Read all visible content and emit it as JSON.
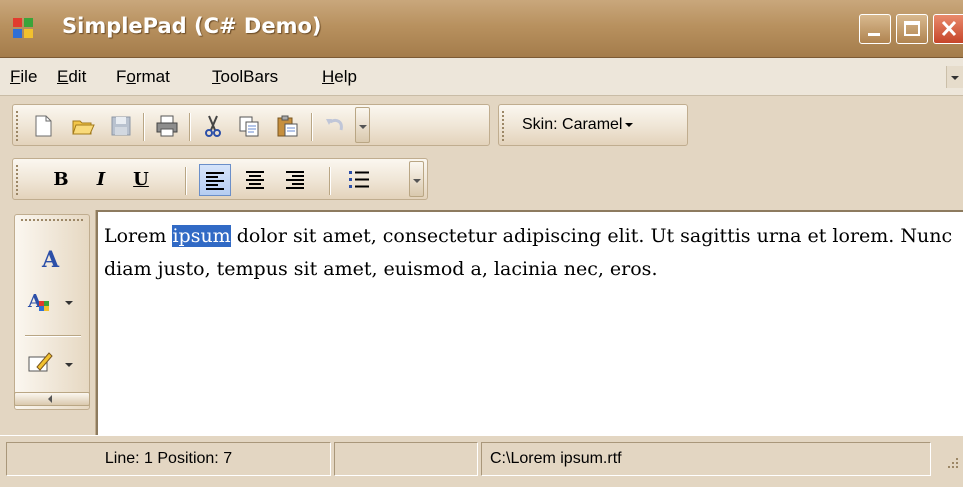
{
  "window": {
    "title": "SimplePad (C# Demo)",
    "controls": [
      "minimize-icon",
      "maximize-icon",
      "close-icon"
    ],
    "colors": {
      "titlebar": "#b8915f",
      "selection": "#316ac5",
      "background": "#e3d6c2"
    }
  },
  "menu": {
    "items": [
      {
        "label": "File",
        "mnemonic": "F"
      },
      {
        "label": "Edit",
        "mnemonic": "E"
      },
      {
        "label": "Format",
        "mnemonic": "o"
      },
      {
        "label": "ToolBars",
        "mnemonic": "T"
      },
      {
        "label": "Help",
        "mnemonic": "H"
      }
    ]
  },
  "toolbar_main": {
    "icons": [
      "new-document-icon",
      "open-folder-icon",
      "save-icon",
      "print-icon",
      "cut-icon",
      "copy-icon",
      "paste-icon",
      "undo-icon"
    ],
    "skin_label": "Skin: Caramel"
  },
  "toolbar_format": {
    "bold": "B",
    "italic": "I",
    "underline": "U",
    "active_alignment": "left",
    "icons": [
      "align-left-icon",
      "align-center-icon",
      "align-right-icon",
      "bullet-list-icon"
    ]
  },
  "toolbar_side": {
    "icons": [
      "font-icon",
      "font-color-icon",
      "edit-style-icon"
    ]
  },
  "editor": {
    "text_before": "Lorem ",
    "selected_text": "ipsum",
    "text_after": " dolor sit amet, consectetur adipiscing elit. Ut sagittis urna et lorem. Nunc diam justo, tempus sit amet, euismod a, lacinia nec, eros."
  },
  "status": {
    "position": "Line: 1  Position: 7",
    "empty": "",
    "file_path": "C:\\Lorem ipsum.rtf"
  }
}
